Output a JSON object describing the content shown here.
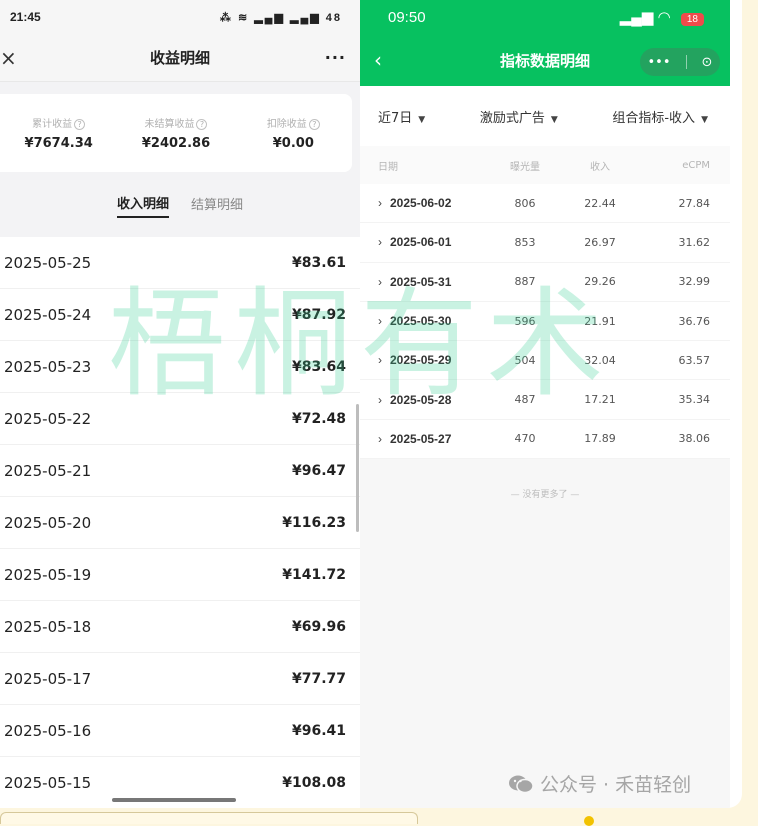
{
  "left": {
    "status_time": "21:45",
    "status_icons": "⁂ ≋ ▂▄▆ ▂▄▆ 48",
    "nav": {
      "close": "×",
      "title": "收益明细",
      "more": "···"
    },
    "summary": [
      {
        "label": "累计收益",
        "value": "¥7674.34"
      },
      {
        "label": "未结算收益",
        "value": "¥2402.86"
      },
      {
        "label": "扣除收益",
        "value": "¥0.00"
      }
    ],
    "help_glyph": "?",
    "tabs": [
      "收入明细",
      "结算明细"
    ],
    "rows": [
      {
        "date": "2025-05-25",
        "amount": "¥83.61"
      },
      {
        "date": "2025-05-24",
        "amount": "¥87.92"
      },
      {
        "date": "2025-05-23",
        "amount": "¥83.64"
      },
      {
        "date": "2025-05-22",
        "amount": "¥72.48"
      },
      {
        "date": "2025-05-21",
        "amount": "¥96.47"
      },
      {
        "date": "2025-05-20",
        "amount": "¥116.23"
      },
      {
        "date": "2025-05-19",
        "amount": "¥141.72"
      },
      {
        "date": "2025-05-18",
        "amount": "¥69.96"
      },
      {
        "date": "2025-05-17",
        "amount": "¥77.77"
      },
      {
        "date": "2025-05-16",
        "amount": "¥96.41"
      },
      {
        "date": "2025-05-15",
        "amount": "¥108.08"
      }
    ]
  },
  "right": {
    "status_time": "09:50",
    "battery": "18",
    "nav": {
      "back": "‹",
      "title": "指标数据明细",
      "capsule_more": "•••",
      "capsule_close": "⊙"
    },
    "filters": [
      "近7日",
      "激励式广告",
      "组合指标-收入"
    ],
    "table_headers": [
      "日期",
      "曝光量",
      "收入",
      "eCPM"
    ],
    "table_rows": [
      {
        "date": "2025-06-02",
        "exposure": "806",
        "income": "22.44",
        "ecpm": "27.84"
      },
      {
        "date": "2025-06-01",
        "exposure": "853",
        "income": "26.97",
        "ecpm": "31.62"
      },
      {
        "date": "2025-05-31",
        "exposure": "887",
        "income": "29.26",
        "ecpm": "32.99"
      },
      {
        "date": "2025-05-30",
        "exposure": "596",
        "income": "21.91",
        "ecpm": "36.76"
      },
      {
        "date": "2025-05-29",
        "exposure": "504",
        "income": "32.04",
        "ecpm": "63.57"
      },
      {
        "date": "2025-05-28",
        "exposure": "487",
        "income": "17.21",
        "ecpm": "35.34"
      },
      {
        "date": "2025-05-27",
        "exposure": "470",
        "income": "17.89",
        "ecpm": "38.06"
      }
    ],
    "no_more": "— 没有更多了 —",
    "brand": "公众号 · 禾苗轻创"
  },
  "watermark": "梧桐有术",
  "colors": {
    "wechat_green": "#07c160",
    "watermark": "#2ecc8f"
  }
}
